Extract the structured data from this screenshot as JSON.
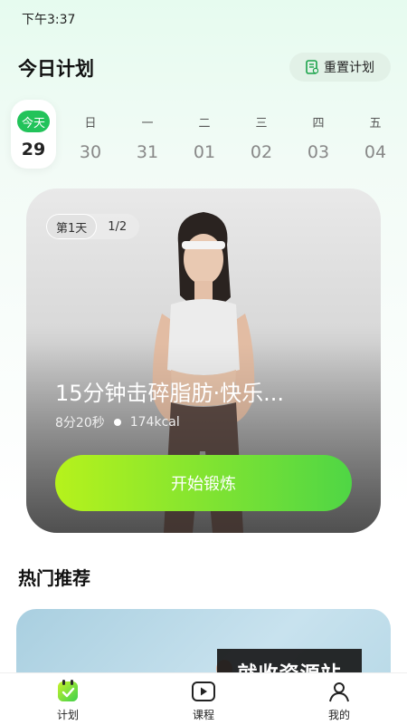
{
  "status_bar": {
    "time": "下午3:37"
  },
  "header": {
    "title": "今日计划",
    "reset_label": "重置计划"
  },
  "week": [
    {
      "label": "今天",
      "date": "29",
      "today": true
    },
    {
      "label": "日",
      "date": "30"
    },
    {
      "label": "一",
      "date": "31"
    },
    {
      "label": "二",
      "date": "01"
    },
    {
      "label": "三",
      "date": "02"
    },
    {
      "label": "四",
      "date": "03"
    },
    {
      "label": "五",
      "date": "04"
    }
  ],
  "workout": {
    "day_tag": "第1天",
    "progress": "1/2",
    "title": "15分钟击碎脂肪·快乐...",
    "duration": "8分20秒",
    "calories": "174kcal",
    "start_label": "开始锻炼"
  },
  "hot": {
    "title": "热门推荐"
  },
  "watermark": "就收资源站",
  "tabs": [
    {
      "label": "计划",
      "icon": "plan-icon",
      "active": true
    },
    {
      "label": "课程",
      "icon": "video-icon"
    },
    {
      "label": "我的",
      "icon": "profile-icon"
    }
  ],
  "colors": {
    "accent": "#22c35a",
    "button_start": "#b6f21c",
    "button_end": "#4fd645"
  }
}
